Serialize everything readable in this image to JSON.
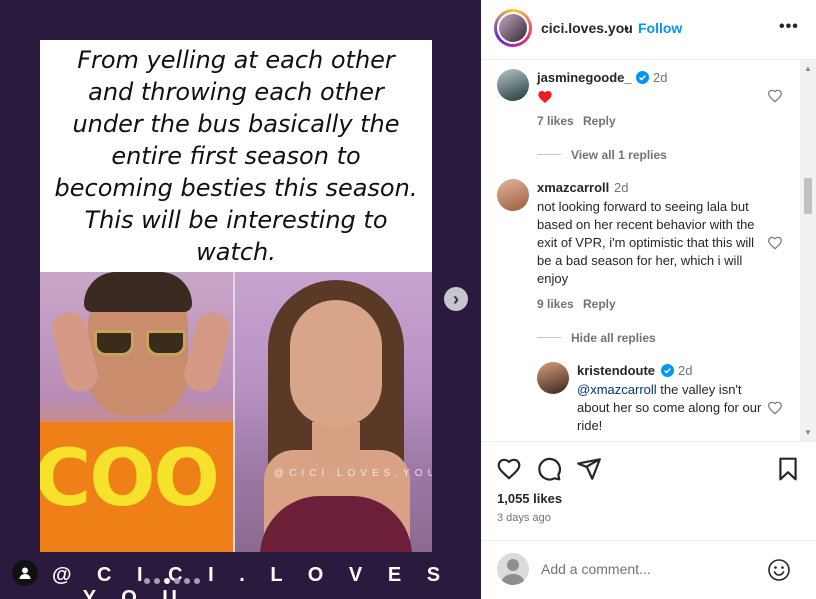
{
  "post": {
    "quote_text": "From yelling at each other and throwing each other under the bus basically the entire first season to becoming besties this season. This will be interesting to watch.",
    "image_overlay_word": "COO",
    "image_watermark": "@CICI.LOVES.YOU",
    "bottom_watermark": "@ C I C I . L O V E S . Y O U",
    "carousel_dots": 6,
    "active_dot": 2
  },
  "header": {
    "username": "cici.loves.you",
    "separator": "•",
    "follow_label": "Follow",
    "more_label": "•••"
  },
  "comments": [
    {
      "username": "jasminegoode_",
      "verified": true,
      "time": "2d",
      "text": "❤️",
      "likes": "7 likes",
      "reply_label": "Reply",
      "view_replies": "View all 1 replies"
    },
    {
      "username": "xmazcarroll",
      "verified": false,
      "time": "2d",
      "text": "not looking forward to seeing lala but based on her recent behavior with the exit of VPR, i'm optimistic that this will be a bad season for her, which i will enjoy",
      "likes": "9 likes",
      "reply_label": "Reply",
      "view_replies": "Hide all replies"
    },
    {
      "username": "kristendoute",
      "verified": true,
      "time": "2d",
      "mention": "@xmazcarroll",
      "text": " the valley isn't about her so come along for our ride!"
    }
  ],
  "actions": {
    "likes": "1,055 likes",
    "date": "3 days ago"
  },
  "add_comment": {
    "placeholder": "Add a comment..."
  },
  "colors": {
    "accent": "#0095f6",
    "verified": "#0095f6",
    "heart_red": "#ed1c24",
    "media_bg": "#2a1a3e"
  }
}
